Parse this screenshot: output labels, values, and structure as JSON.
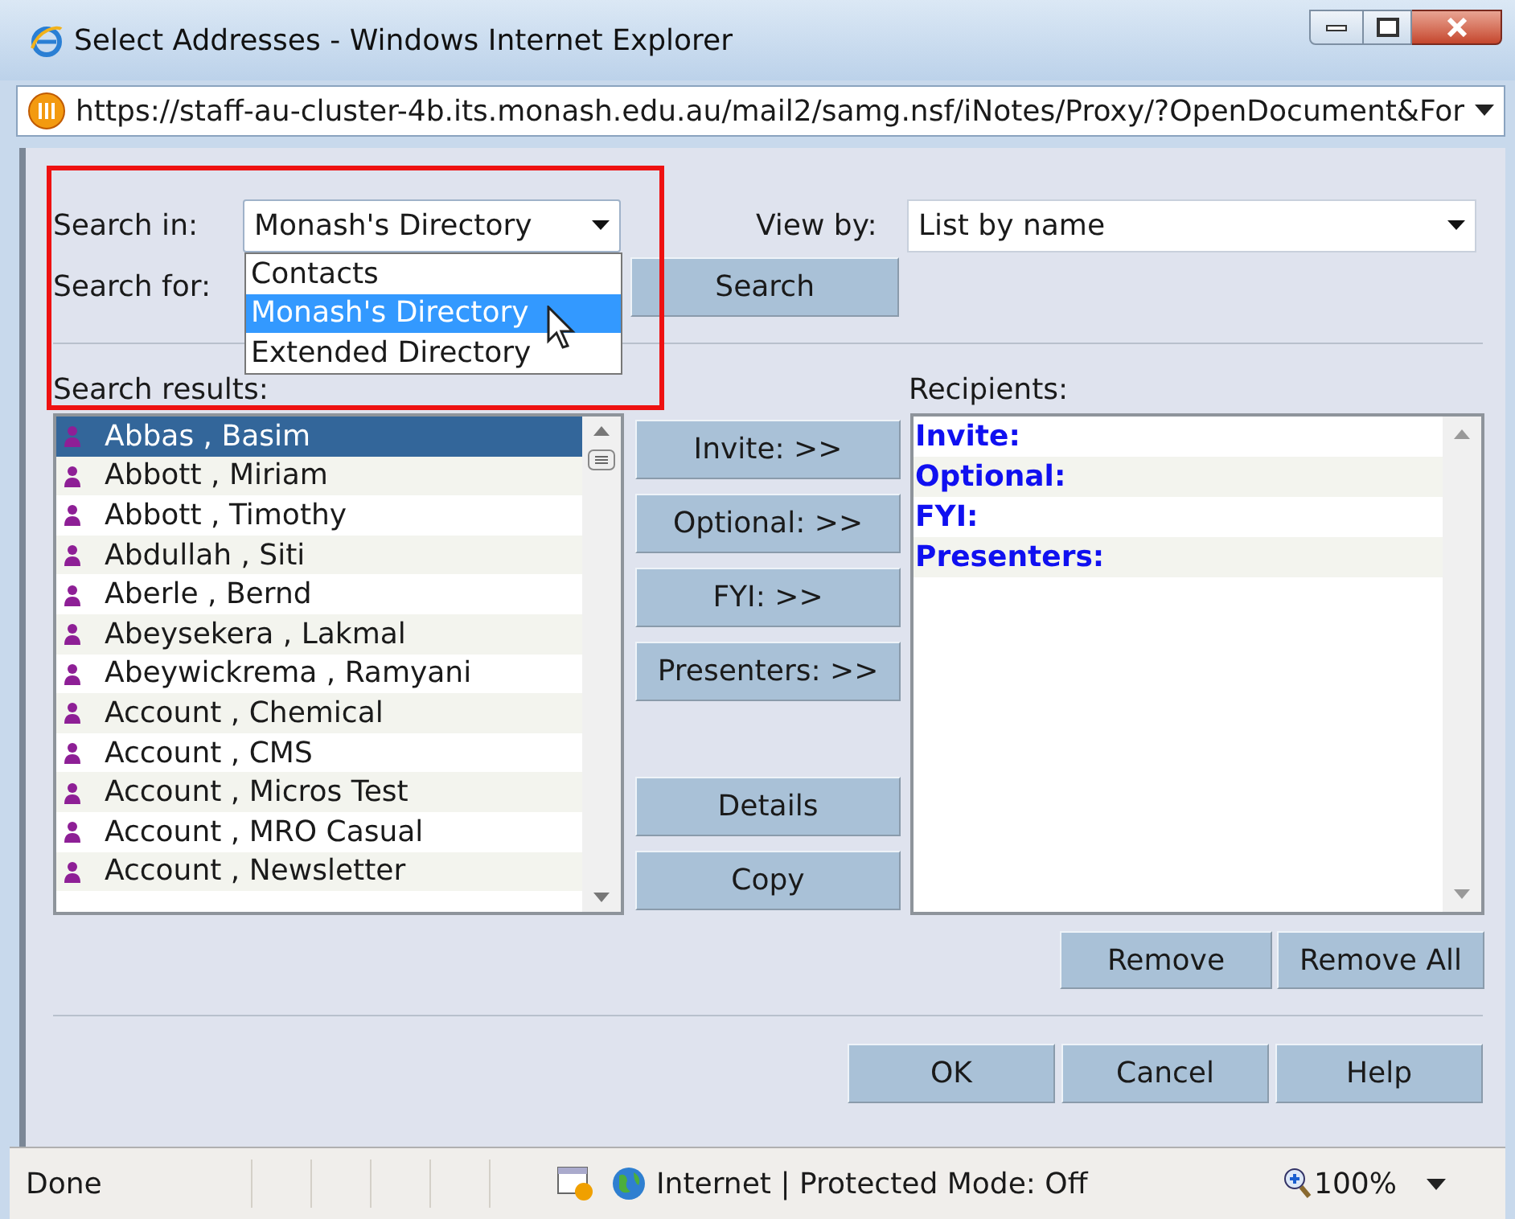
{
  "window": {
    "title": "Select Addresses - Windows Internet Explorer"
  },
  "address_bar": {
    "url": "https://staff-au-cluster-4b.its.monash.edu.au/mail2/samg.nsf/iNotes/Proxy/?OpenDocument&For"
  },
  "search_in": {
    "label": "Search in:",
    "value": "Monash's Directory",
    "options": [
      {
        "label": "Contacts",
        "selected": false
      },
      {
        "label": "Monash's Directory",
        "selected": true
      },
      {
        "label": "Extended Directory",
        "selected": false
      }
    ]
  },
  "view_by": {
    "label": "View by:",
    "value": "List by name"
  },
  "search_for": {
    "label": "Search for:"
  },
  "search_button": "Search",
  "search_results": {
    "label": "Search results:",
    "rows": [
      {
        "name": "Abbas , Basim",
        "selected": true
      },
      {
        "name": "Abbott , Miriam",
        "selected": false
      },
      {
        "name": "Abbott , Timothy",
        "selected": false
      },
      {
        "name": "Abdullah , Siti",
        "selected": false
      },
      {
        "name": "Aberle , Bernd",
        "selected": false
      },
      {
        "name": "Abeysekera , Lakmal",
        "selected": false
      },
      {
        "name": "Abeywickrema , Ramyani",
        "selected": false
      },
      {
        "name": "Account , Chemical",
        "selected": false
      },
      {
        "name": "Account , CMS",
        "selected": false
      },
      {
        "name": "Account , Micros Test",
        "selected": false
      },
      {
        "name": "Account , MRO Casual",
        "selected": false
      },
      {
        "name": "Account , Newsletter",
        "selected": false
      }
    ]
  },
  "add_buttons": [
    "Invite: >>",
    "Optional: >>",
    "FYI: >>",
    "Presenters: >>"
  ],
  "list_buttons": [
    "Details",
    "Copy"
  ],
  "recipients": {
    "label": "Recipients:",
    "groups": [
      "Invite:",
      "Optional:",
      "FYI:",
      "Presenters:"
    ]
  },
  "remove_buttons": [
    "Remove",
    "Remove All"
  ],
  "dialog_buttons": [
    "OK",
    "Cancel",
    "Help"
  ],
  "status_bar": {
    "text": "Done",
    "zone": "Internet | Protected Mode: Off",
    "zoom": "100%"
  }
}
